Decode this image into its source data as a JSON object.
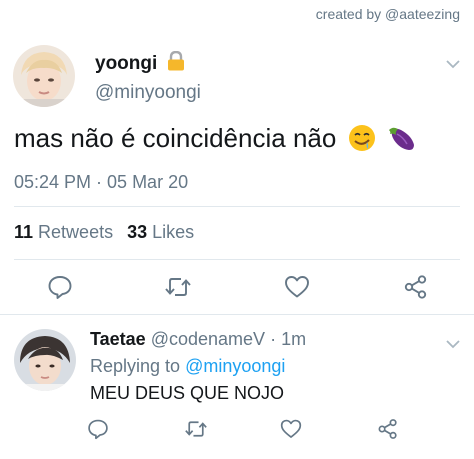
{
  "credit": "created by @aateezing",
  "tweet": {
    "display_name": "yoongi",
    "handle": "@minyoongi",
    "text": "mas não é coincidência não",
    "emojis": [
      "smirking-drooling-face-emoji",
      "eggplant-emoji"
    ],
    "timestamp": "05:24 PM · 05 Mar 20",
    "retweets_count": "11",
    "retweets_label": "Retweets",
    "likes_count": "33",
    "likes_label": "Likes"
  },
  "reply": {
    "display_name": "Taetae",
    "handle": "@codenameV",
    "separator": "·",
    "age": "1m",
    "replying_prefix": "Replying to",
    "replying_to": "@minyoongi",
    "text": "MEU DEUS QUE NOJO"
  },
  "icons": {
    "reply": "reply-icon",
    "retweet": "retweet-icon",
    "like": "heart-icon",
    "share": "share-icon",
    "lock": "lock-icon",
    "chevron": "chevron-down-icon"
  },
  "colors": {
    "text": "#14171a",
    "muted": "#657786",
    "link": "#1da1f2",
    "divider": "#e1e8ed"
  }
}
